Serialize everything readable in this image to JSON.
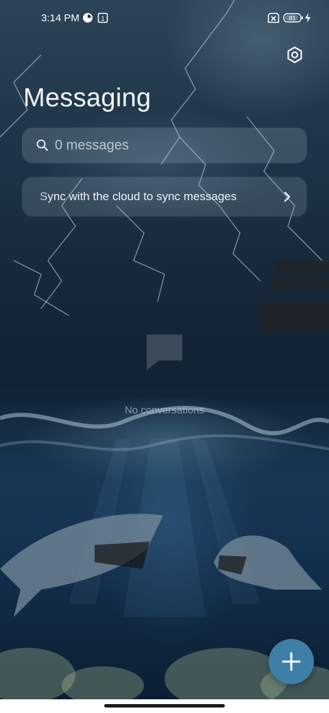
{
  "status_bar": {
    "time": "3:14 PM",
    "sim_badge": "1",
    "battery_level": "81",
    "icons": [
      "data-saver-icon",
      "sim-card-icon",
      "no-sim-icon",
      "battery-icon",
      "charging-bolt-icon"
    ]
  },
  "header": {
    "title": "Messaging",
    "settings_icon": "gear-icon"
  },
  "search": {
    "placeholder": "0 messages",
    "value": "",
    "icon": "search-icon"
  },
  "sync_banner": {
    "text": "Sync with the cloud to sync messages",
    "icon": "chevron-right-icon"
  },
  "empty_state": {
    "icon": "message-bubble-icon",
    "text": "No conversations"
  },
  "fab": {
    "icon": "plus-icon"
  },
  "colors": {
    "fab": "#3e7fa8",
    "title": "#f1f4f7",
    "wallpaper_top": "#2c4457",
    "wallpaper_bottom": "#0b1e32"
  }
}
